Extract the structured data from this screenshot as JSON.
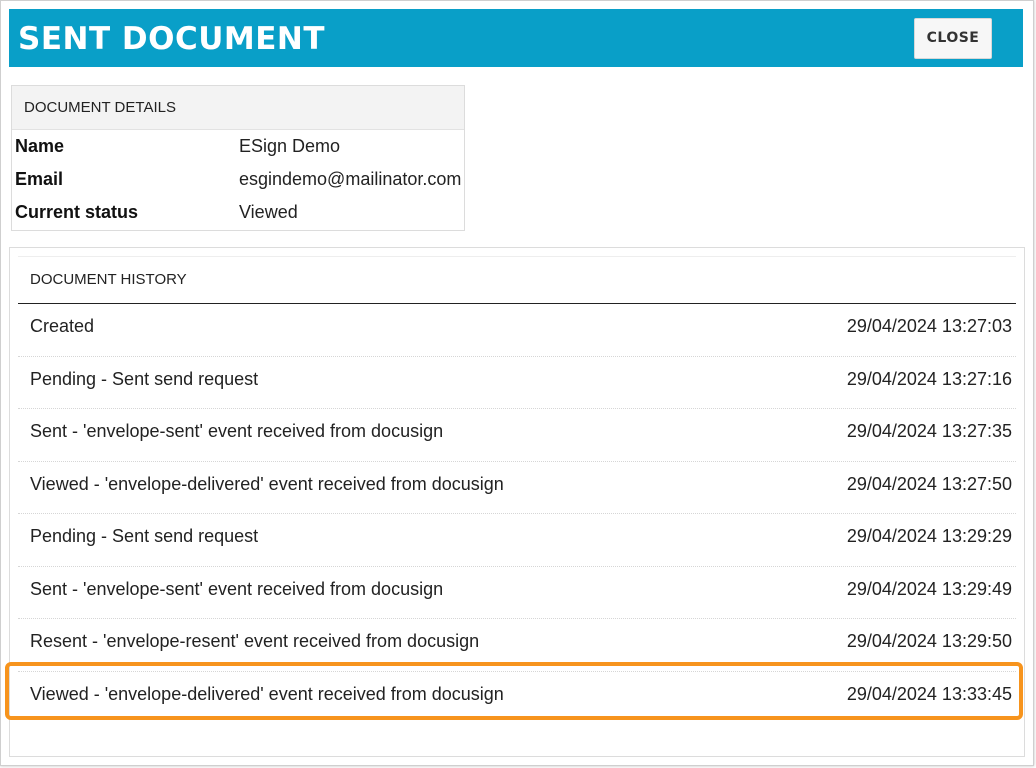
{
  "header": {
    "title": "SENT DOCUMENT",
    "close_label": "CLOSE"
  },
  "details": {
    "heading": "DOCUMENT DETAILS",
    "fields": [
      {
        "label": "Name",
        "value": "ESign Demo"
      },
      {
        "label": "Email",
        "value": "esgindemo@mailinator.com"
      },
      {
        "label": "Current status",
        "value": "Viewed"
      }
    ]
  },
  "history": {
    "heading": "DOCUMENT HISTORY",
    "rows": [
      {
        "desc": "Created",
        "time": "29/04/2024 13:27:03"
      },
      {
        "desc": "Pending - Sent send request",
        "time": "29/04/2024 13:27:16"
      },
      {
        "desc": "Sent - 'envelope-sent' event received from docusign",
        "time": "29/04/2024 13:27:35"
      },
      {
        "desc": "Viewed - 'envelope-delivered' event received from docusign",
        "time": "29/04/2024 13:27:50"
      },
      {
        "desc": "Pending - Sent send request",
        "time": "29/04/2024 13:29:29"
      },
      {
        "desc": "Sent - 'envelope-sent' event received from docusign",
        "time": "29/04/2024 13:29:49"
      },
      {
        "desc": "Resent - 'envelope-resent' event received from docusign",
        "time": "29/04/2024 13:29:50"
      },
      {
        "desc": "Viewed - 'envelope-delivered' event received from docusign",
        "time": "29/04/2024 13:33:45"
      }
    ]
  },
  "colors": {
    "header_bg": "#099fc8",
    "highlight": "#f7941d"
  }
}
